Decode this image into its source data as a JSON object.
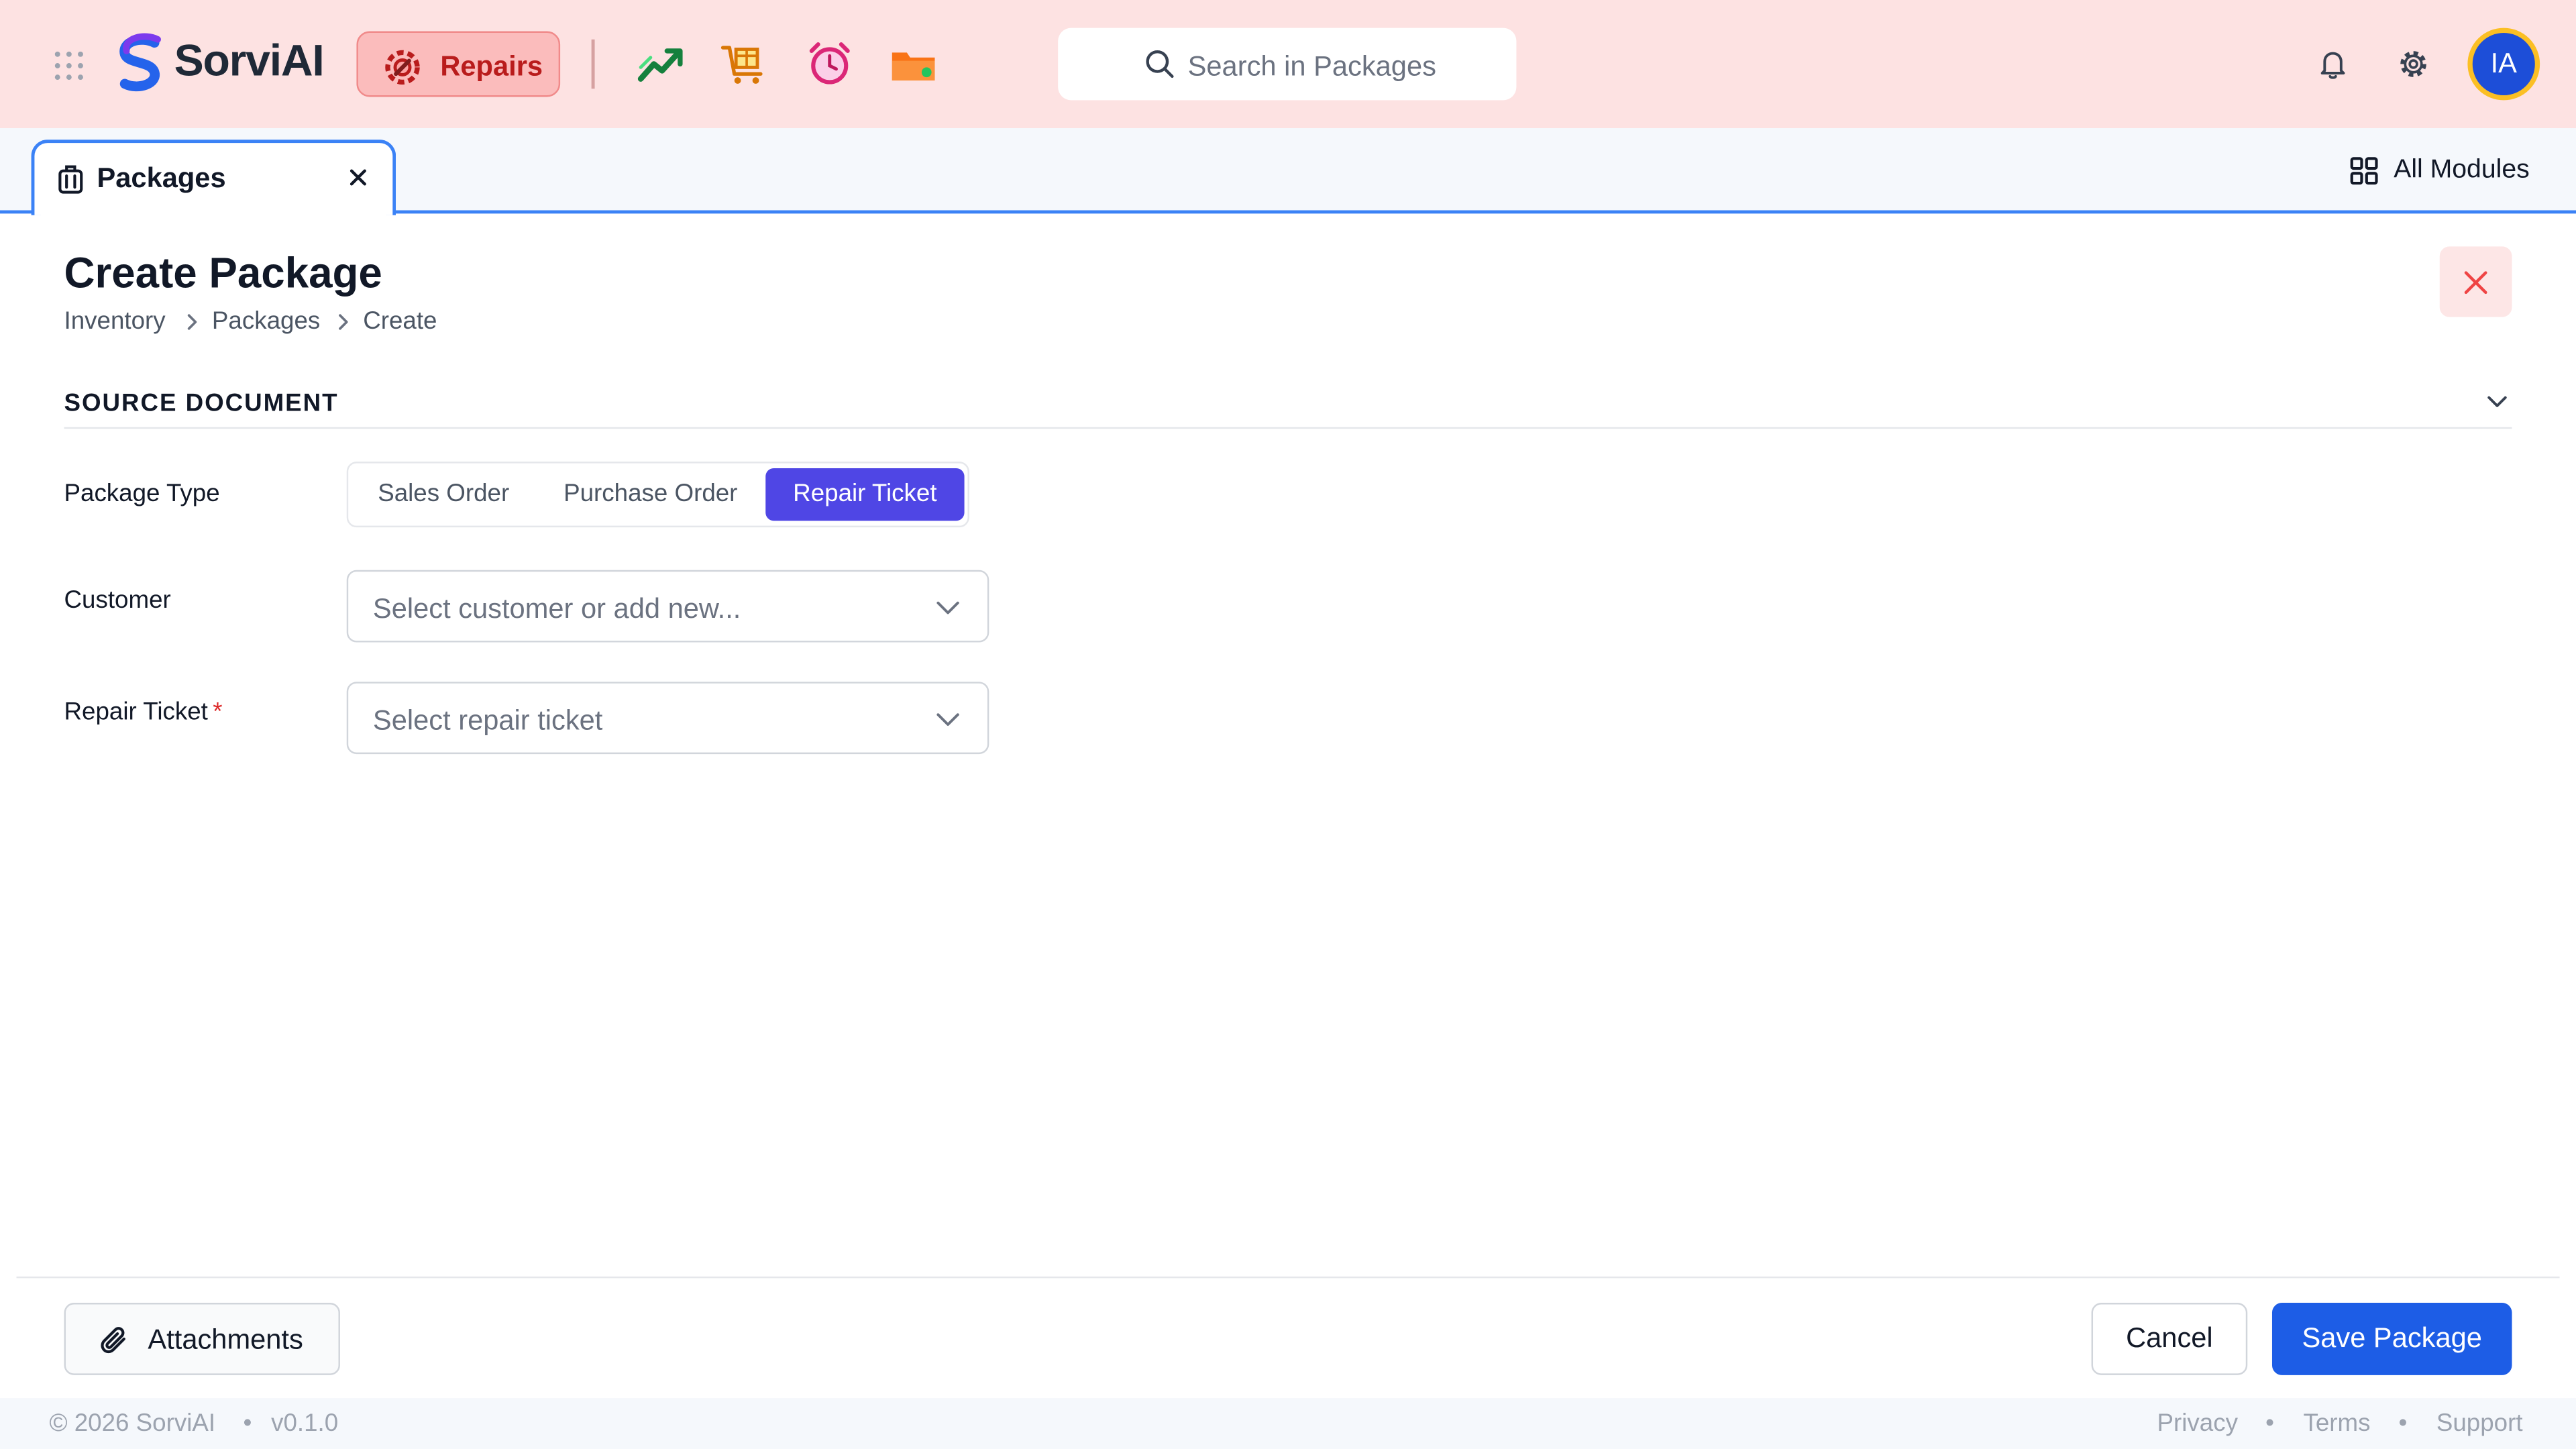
{
  "header": {
    "brand": "SorviAI",
    "active_module": "Repairs",
    "search_placeholder": "Search in Packages",
    "avatar_initials": "IA",
    "app_icons": [
      "trend-chart-icon",
      "shopping-cart-box-icon",
      "alarm-clock-icon",
      "folder-icon"
    ]
  },
  "tabs": {
    "open_tab": "Packages",
    "all_modules": "All Modules"
  },
  "page": {
    "title": "Create Package",
    "breadcrumb": [
      "Inventory",
      "Packages",
      "Create"
    ]
  },
  "section": {
    "title": "SOURCE DOCUMENT"
  },
  "form": {
    "package_type": {
      "label": "Package Type",
      "options": [
        "Sales Order",
        "Purchase Order",
        "Repair Ticket"
      ],
      "selected": "Repair Ticket"
    },
    "customer": {
      "label": "Customer",
      "placeholder": "Select customer or add new..."
    },
    "repair_ticket": {
      "label": "Repair Ticket",
      "required_marker": "*",
      "placeholder": "Select repair ticket"
    }
  },
  "actions": {
    "attachments": "Attachments",
    "cancel": "Cancel",
    "save": "Save Package"
  },
  "footer": {
    "copyright": "© 2026 SorviAI",
    "version": "v0.1.0",
    "links": [
      "Privacy",
      "Terms",
      "Support"
    ],
    "separator": "•"
  },
  "colors": {
    "header_bg": "#fde2e2",
    "module_accent": "#b91c1c",
    "segment_active": "#4f46e5",
    "primary_button": "#1d5de6",
    "tab_accent": "#3b82f6",
    "avatar_bg": "#1d4ed8",
    "avatar_ring": "#fbbf24"
  }
}
